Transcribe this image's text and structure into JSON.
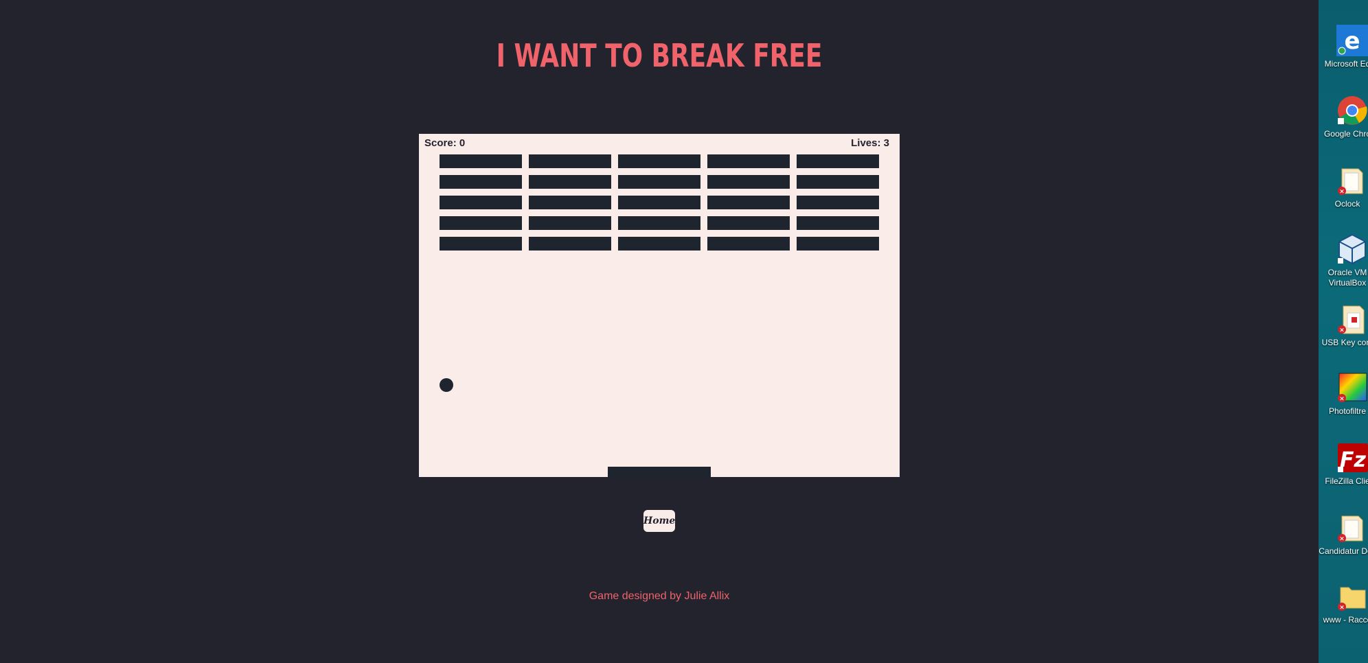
{
  "page": {
    "title": "I WANT TO BREAK FREE",
    "footer": "Game designed by Julie Allix"
  },
  "game": {
    "score_label": "Score: 0",
    "lives_label": "Lives: 3",
    "score": 0,
    "lives": 3,
    "brick_rows": 5,
    "brick_columns": 5,
    "bricks_remaining": 25
  },
  "nav": {
    "home_label": "Home"
  },
  "colors": {
    "background": "#23232e",
    "accent": "#f0636b",
    "canvas": "#faece9",
    "bricks": "#1f252e"
  },
  "desktop": {
    "icons": [
      {
        "label": "Microsoft Ed",
        "icon": "edge-icon"
      },
      {
        "label": "Google Chro",
        "icon": "chrome-icon"
      },
      {
        "label": "Oclock",
        "icon": "folder-icon"
      },
      {
        "label": "Oracle VM VirtualBox",
        "icon": "virtualbox-icon"
      },
      {
        "label": "USB Key cont",
        "icon": "document-icon"
      },
      {
        "label": "Photofiltre",
        "icon": "photofiltre-icon"
      },
      {
        "label": "FileZilla Clie",
        "icon": "filezilla-icon"
      },
      {
        "label": "Candidatur Dev",
        "icon": "folder-icon"
      },
      {
        "label": "www - Racco",
        "icon": "folder-icon"
      }
    ]
  }
}
